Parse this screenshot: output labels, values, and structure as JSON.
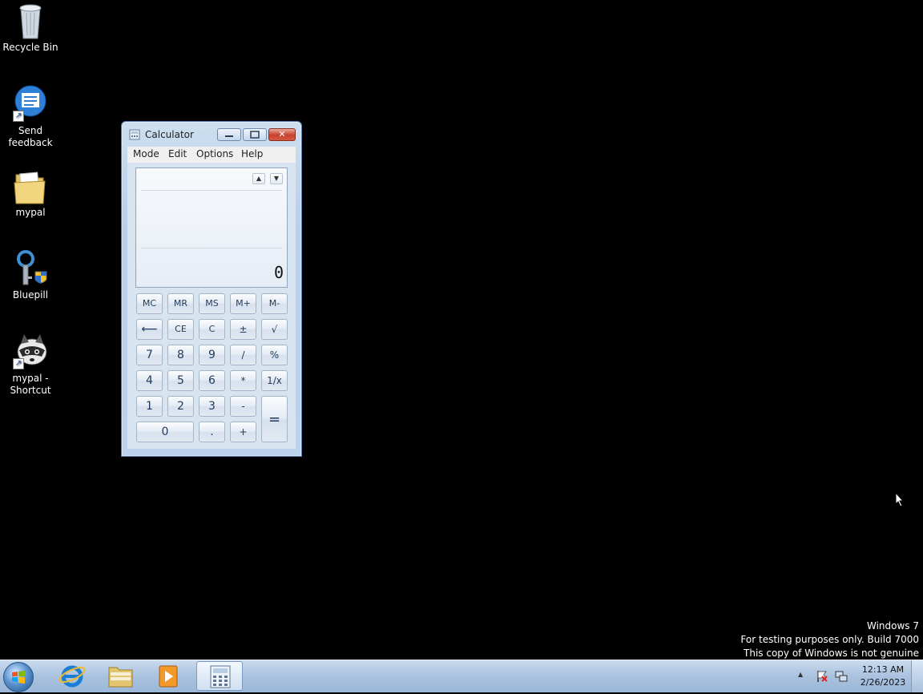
{
  "desktop": {
    "icons": [
      {
        "label": "Recycle Bin",
        "icon": "recycle-bin-icon"
      },
      {
        "label": "Send feedback",
        "icon": "feedback-icon"
      },
      {
        "label": "mypal",
        "icon": "folder-icon"
      },
      {
        "label": "Bluepill",
        "icon": "keys-shield-icon"
      },
      {
        "label": "mypal - Shortcut",
        "icon": "raccoon-icon"
      }
    ]
  },
  "calculator": {
    "title": "Calculator",
    "close_glyph": "✕",
    "menu": [
      "Mode",
      "Edit",
      "Options",
      "Help"
    ],
    "display_value": "0",
    "history_up": "▲",
    "history_down": "▼",
    "keys": {
      "mc": "MC",
      "mr": "MR",
      "ms": "MS",
      "mplus": "M+",
      "mminus": "M-",
      "back": "⟵",
      "ce": "CE",
      "c": "C",
      "plusminus": "±",
      "sqrt": "√",
      "k7": "7",
      "k8": "8",
      "k9": "9",
      "div": "/",
      "pct": "%",
      "k4": "4",
      "k5": "5",
      "k6": "6",
      "mul": "*",
      "recip": "1/x",
      "k1": "1",
      "k2": "2",
      "k3": "3",
      "minus": "-",
      "equals": "=",
      "k0": "0",
      "dot": ".",
      "plus": "+"
    }
  },
  "watermark": {
    "line1": "Windows  7",
    "line2": "For testing purposes only. Build 7000",
    "line3": "This copy of Windows is not genuine"
  },
  "taskbar": {
    "apps": [
      "internet-explorer-icon",
      "windows-explorer-icon",
      "media-player-icon",
      "calculator-icon"
    ],
    "tray_arrow": "▲",
    "clock_time": "12:13 AM",
    "clock_date": "2/26/2023"
  }
}
